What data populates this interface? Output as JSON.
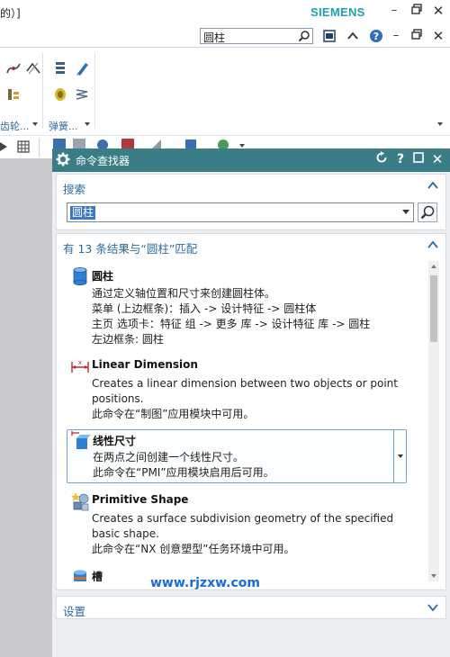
{
  "window": {
    "title_fragment": "的）]",
    "brand": "SIEMENS",
    "brand_color": "#1ca0b4"
  },
  "command_search": {
    "value": "圆柱"
  },
  "ribbon": {
    "groups": [
      {
        "label": "齿轮...",
        "icons": [
          "curve-tool-icon",
          "curve-tool-2-icon",
          "gear-array-icon"
        ]
      },
      {
        "label": "弹簧...",
        "icons": [
          "stack-icon",
          "pen-icon",
          "coil-icon",
          "spring-icon"
        ]
      }
    ]
  },
  "finder": {
    "title": "命令查找器",
    "search_section": {
      "title": "搜索",
      "query": "圆柱"
    },
    "results_section": {
      "title": "有 13 条结果与“圆柱”匹配",
      "items": [
        {
          "title": "圆柱",
          "icon": "cylinder-icon",
          "lines": [
            "通过定义轴位置和尺寸来创建圆柱体。",
            "菜单 (上边框条)：插入 -> 设计特征 -> 圆柱体",
            "主页 选项卡：特征 组 -> 更多 库 -> 设计特征 库 -> 圆柱",
            "左边框条: 圆柱"
          ]
        },
        {
          "title": "Linear Dimension",
          "icon": "linear-dimension-icon",
          "lines": [
            "Creates a linear dimension between two objects or point",
            "positions.",
            "此命令在“制图”应用模块中可用。"
          ]
        },
        {
          "title": "线性尺寸",
          "icon": "pmi-linear-dimension-icon",
          "lines": [
            "在两点之间创建一个线性尺寸。",
            "此命令在“PMI”应用模块启用后可用。"
          ]
        },
        {
          "title": "Primitive Shape",
          "icon": "primitive-shape-icon",
          "lines": [
            "Creates a surface subdivision geometry of the specified",
            "basic shape.",
            "此命令在“NX 创意塑型”任务环境中可用。"
          ]
        },
        {
          "title": "槽",
          "icon": "groove-icon",
          "lines": []
        }
      ]
    },
    "settings_section": {
      "title": "设置"
    }
  },
  "watermark": "www.rjzxw.com",
  "colors": {
    "accent": "#2c6aa0",
    "panel_header": "#3b7d86",
    "selection": "#3a78c2"
  }
}
